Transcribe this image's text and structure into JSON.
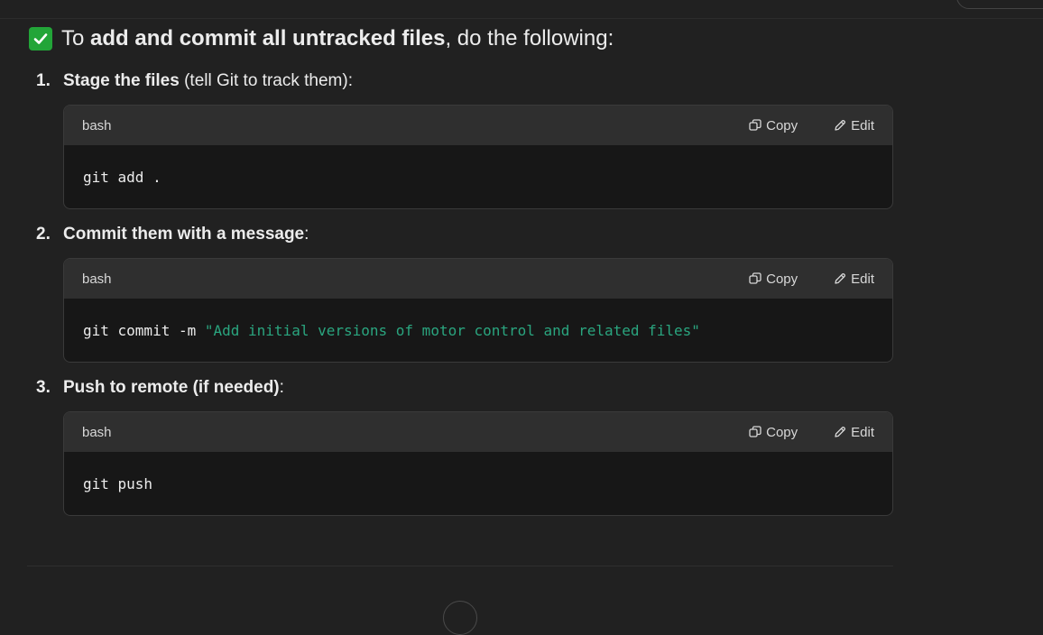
{
  "heading": {
    "prefix": "To ",
    "bold": "add and commit all untracked files",
    "suffix": ", do the following:"
  },
  "steps": [
    {
      "number": "1.",
      "bold": "Stage the files",
      "rest": " (tell Git to track them):",
      "code": {
        "lang": "bash",
        "copy_label": "Copy",
        "edit_label": "Edit",
        "command": "git add ."
      }
    },
    {
      "number": "2.",
      "bold": "Commit them with a message",
      "rest": ":",
      "code": {
        "lang": "bash",
        "copy_label": "Copy",
        "edit_label": "Edit",
        "command": "git commit -m ",
        "string": "\"Add initial versions of motor control and related files\""
      }
    },
    {
      "number": "3.",
      "bold": "Push to remote (if needed)",
      "rest": ":",
      "code": {
        "lang": "bash",
        "copy_label": "Copy",
        "edit_label": "Edit",
        "command": "git push"
      }
    }
  ],
  "colors": {
    "background": "#212121",
    "code_header": "#2f2f2f",
    "code_body": "#171717",
    "check_green": "#22a538",
    "string_green": "#2aa57f"
  },
  "icons": [
    "check-icon",
    "copy-icon",
    "edit-icon"
  ]
}
